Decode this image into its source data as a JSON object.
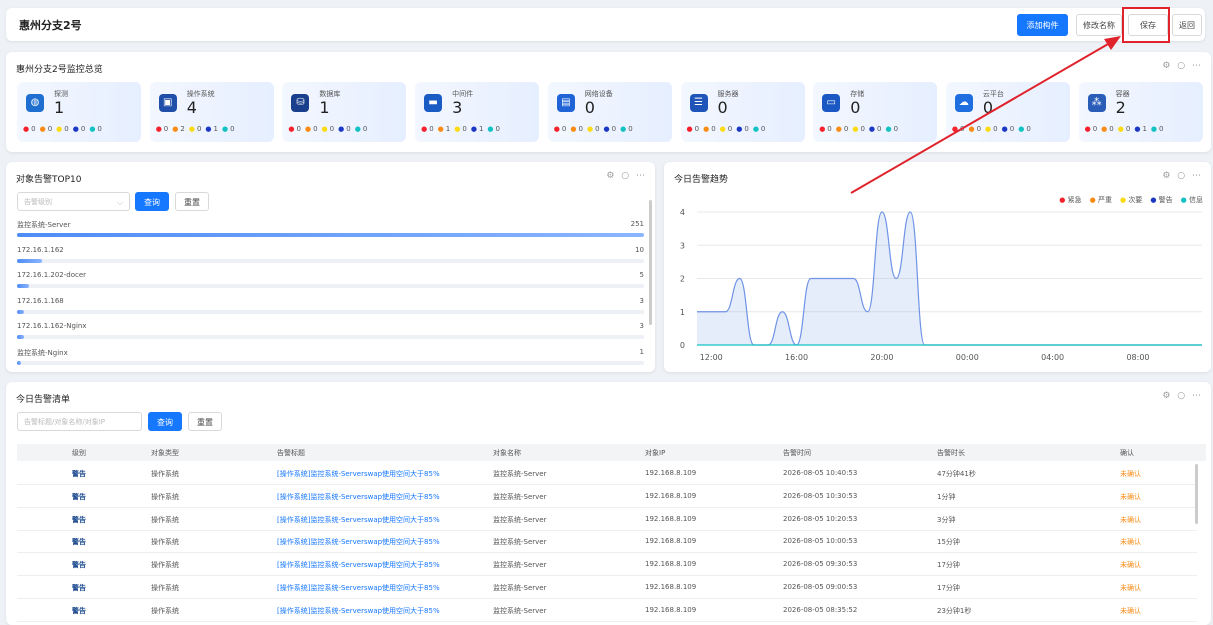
{
  "header": {
    "title": "惠州分支2号",
    "buttons": {
      "add_component": "添加构件",
      "rename": "修改名称",
      "save": "保存",
      "back": "返回"
    }
  },
  "overview": {
    "title": "惠州分支2号监控总览",
    "tools": "⚙ ○ ⋯",
    "cards": [
      {
        "name": "探测",
        "count": "1",
        "icon": "globe-icon",
        "color": "#1f6fd1",
        "levels": [
          "0",
          "0",
          "0",
          "0",
          "0"
        ]
      },
      {
        "name": "操作系统",
        "count": "4",
        "icon": "monitor-icon",
        "color": "#1f4fa8",
        "levels": [
          "0",
          "2",
          "0",
          "1",
          "0"
        ]
      },
      {
        "name": "数据库",
        "count": "1",
        "icon": "database-icon",
        "color": "#1a3f8c",
        "levels": [
          "0",
          "0",
          "0",
          "0",
          "0"
        ]
      },
      {
        "name": "中间件",
        "count": "3",
        "icon": "middleware-icon",
        "color": "#1a5bc4",
        "levels": [
          "0",
          "1",
          "0",
          "1",
          "0"
        ]
      },
      {
        "name": "网络设备",
        "count": "0",
        "icon": "network-device-icon",
        "color": "#1f63d6",
        "levels": [
          "0",
          "0",
          "0",
          "0",
          "0"
        ]
      },
      {
        "name": "服务器",
        "count": "0",
        "icon": "server-icon",
        "color": "#1f55b8",
        "levels": [
          "0",
          "0",
          "0",
          "0",
          "0"
        ]
      },
      {
        "name": "存储",
        "count": "0",
        "icon": "storage-icon",
        "color": "#1c58c4",
        "levels": [
          "0",
          "0",
          "0",
          "0",
          "0"
        ]
      },
      {
        "name": "云平台",
        "count": "0",
        "icon": "cloud-icon",
        "color": "#1e6ee0",
        "levels": [
          "0",
          "0",
          "0",
          "0",
          "0"
        ]
      },
      {
        "name": "容器",
        "count": "2",
        "icon": "container-icon",
        "color": "#2a5db8",
        "levels": [
          "0",
          "0",
          "0",
          "1",
          "0"
        ]
      }
    ]
  },
  "top10": {
    "title": "对象告警TOP10",
    "tools": "⚙ ○ ⋯",
    "select_placeholder": "告警级别",
    "query": "查询",
    "reset": "重置",
    "rows": [
      {
        "name": "监控系统-Server",
        "value": 251
      },
      {
        "name": "172.16.1.162",
        "value": 10
      },
      {
        "name": "172.16.1.202-docer",
        "value": 5
      },
      {
        "name": "172.16.1.168",
        "value": 3
      },
      {
        "name": "172.16.1.162-Nginx",
        "value": 3
      },
      {
        "name": "监控系统-Nginx",
        "value": 1
      }
    ]
  },
  "trend": {
    "title": "今日告警趋势",
    "tools": "⚙ ○ ⋯",
    "legend": [
      "紧急",
      "严重",
      "次要",
      "警告",
      "信息"
    ],
    "legend_colors": [
      "#f5222d",
      "#fa8c16",
      "#fadb14",
      "#1d39c4",
      "#13c2c2"
    ]
  },
  "chart_data": {
    "type": "line",
    "title": "今日告警趋势",
    "x_ticks": [
      "12:00",
      "16:00",
      "20:00",
      "00:00",
      "04:00",
      "08:00"
    ],
    "y_ticks": [
      "0",
      "1",
      "2",
      "3",
      "4"
    ],
    "ylim": [
      0,
      4
    ],
    "x": [
      "11:20",
      "12:00",
      "12:40",
      "13:20",
      "14:00",
      "14:40",
      "15:20",
      "16:00",
      "16:40",
      "17:20",
      "18:00",
      "18:40",
      "19:20",
      "20:00",
      "20:40",
      "21:20",
      "22:00",
      "22:40",
      "23:20",
      "00:00",
      "04:00",
      "08:00",
      "11:00"
    ],
    "series": [
      {
        "name": "警告",
        "color": "#6f94e6",
        "values": [
          1,
          1,
          1,
          2,
          0,
          0,
          1,
          0,
          2,
          2,
          2,
          2,
          1,
          4,
          2,
          4,
          0,
          0,
          0,
          0,
          0,
          0,
          0
        ]
      },
      {
        "name": "信息",
        "color": "#13c2c2",
        "values": [
          0,
          0,
          0,
          0,
          0,
          0,
          0,
          0,
          0,
          0,
          0,
          0,
          0,
          0,
          0,
          0,
          0,
          0,
          0,
          0,
          0,
          0,
          0
        ]
      }
    ],
    "grid": true,
    "legend_position": "top-right"
  },
  "alerts": {
    "title": "今日告警清单",
    "tools": "⚙ ○ ⋯",
    "search_placeholder": "告警标题/对象名称/对象IP",
    "query": "查询",
    "reset": "重置",
    "columns": [
      "级别",
      "对象类型",
      "告警标题",
      "对象名称",
      "对象IP",
      "告警时间",
      "告警时长",
      "确认"
    ],
    "rows": [
      [
        "警告",
        "操作系统",
        "[操作系统]监控系统-Serverswap使用空间大于85%",
        "监控系统-Server",
        "192.168.8.109",
        "2026-08-05 10:40:53",
        "47分钟41秒",
        "未确认"
      ],
      [
        "警告",
        "操作系统",
        "[操作系统]监控系统-Serverswap使用空间大于85%",
        "监控系统-Server",
        "192.168.8.109",
        "2026-08-05 10:30:53",
        "1分钟",
        "未确认"
      ],
      [
        "警告",
        "操作系统",
        "[操作系统]监控系统-Serverswap使用空间大于85%",
        "监控系统-Server",
        "192.168.8.109",
        "2026-08-05 10:20:53",
        "3分钟",
        "未确认"
      ],
      [
        "警告",
        "操作系统",
        "[操作系统]监控系统-Serverswap使用空间大于85%",
        "监控系统-Server",
        "192.168.8.109",
        "2026-08-05 10:00:53",
        "15分钟",
        "未确认"
      ],
      [
        "警告",
        "操作系统",
        "[操作系统]监控系统-Serverswap使用空间大于85%",
        "监控系统-Server",
        "192.168.8.109",
        "2026-08-05 09:30:53",
        "17分钟",
        "未确认"
      ],
      [
        "警告",
        "操作系统",
        "[操作系统]监控系统-Serverswap使用空间大于85%",
        "监控系统-Server",
        "192.168.8.109",
        "2026-08-05 09:00:53",
        "17分钟",
        "未确认"
      ],
      [
        "警告",
        "操作系统",
        "[操作系统]监控系统-Serverswap使用空间大于85%",
        "监控系统-Server",
        "192.168.8.109",
        "2026-08-05 08:35:52",
        "23分钟1秒",
        "未确认"
      ]
    ]
  }
}
